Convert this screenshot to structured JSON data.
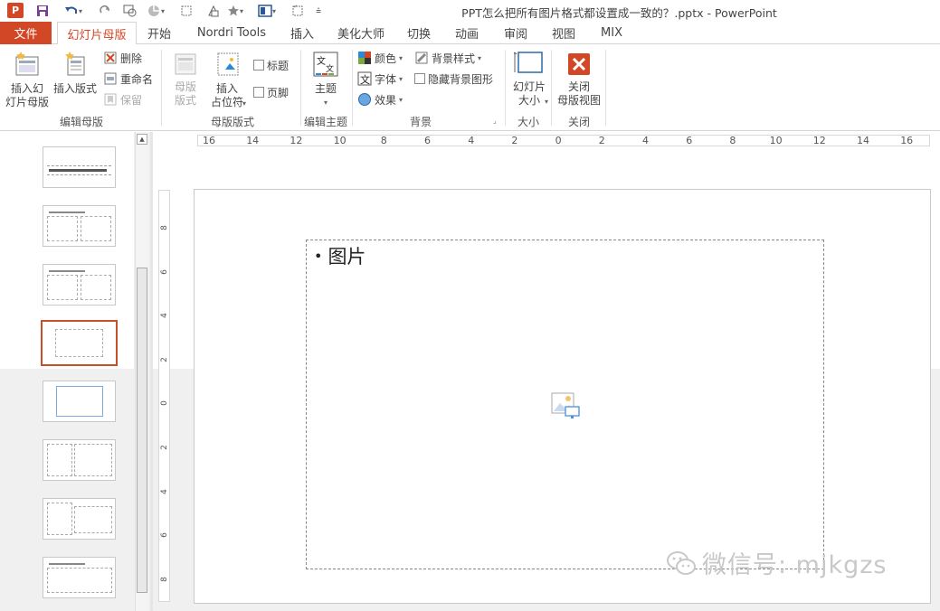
{
  "window": {
    "title": "PPT怎么把所有图片格式都设置成一致的？.pptx - PowerPoint",
    "app_icon": "P"
  },
  "tabs": {
    "file": "文件",
    "items": [
      "幻灯片母版",
      "开始",
      "Nordri Tools",
      "插入",
      "美化大师",
      "切换",
      "动画",
      "审阅",
      "视图",
      "MIX"
    ],
    "active_index": 0
  },
  "ribbon": {
    "insert_master": "插入幻\n灯片母版",
    "insert_layout": "插入版式",
    "delete": "删除",
    "rename": "重命名",
    "preserve": "保留",
    "group_edit_master": "编辑母版",
    "master_layout": "母版\n版式",
    "insert_placeholder": "插入\n占位符",
    "title_check": "标题",
    "footer_check": "页脚",
    "group_master_layout": "母版版式",
    "themes": "主题",
    "group_edit_theme": "编辑主题",
    "colors": "颜色",
    "fonts": "字体",
    "effects": "效果",
    "background_styles": "背景样式",
    "hide_background": "隐藏背景图形",
    "group_background": "背景",
    "slide_size": "幻灯片\n大小",
    "group_size": "大小",
    "close_master": "关闭\n母版视图",
    "group_close": "关闭"
  },
  "ruler": {
    "h_ticks": [
      "16",
      "14",
      "12",
      "10",
      "8",
      "6",
      "4",
      "2",
      "0",
      "2",
      "4",
      "6",
      "8",
      "10",
      "12",
      "14",
      "16"
    ],
    "v_ticks": [
      "8",
      "6",
      "4",
      "2",
      "0",
      "2",
      "4",
      "6",
      "8"
    ]
  },
  "slide": {
    "placeholder_text": "图片"
  },
  "watermark": {
    "text": "微信号: mjkgzs"
  },
  "colors": {
    "accent": "#d24726",
    "selection": "#c6502a"
  }
}
